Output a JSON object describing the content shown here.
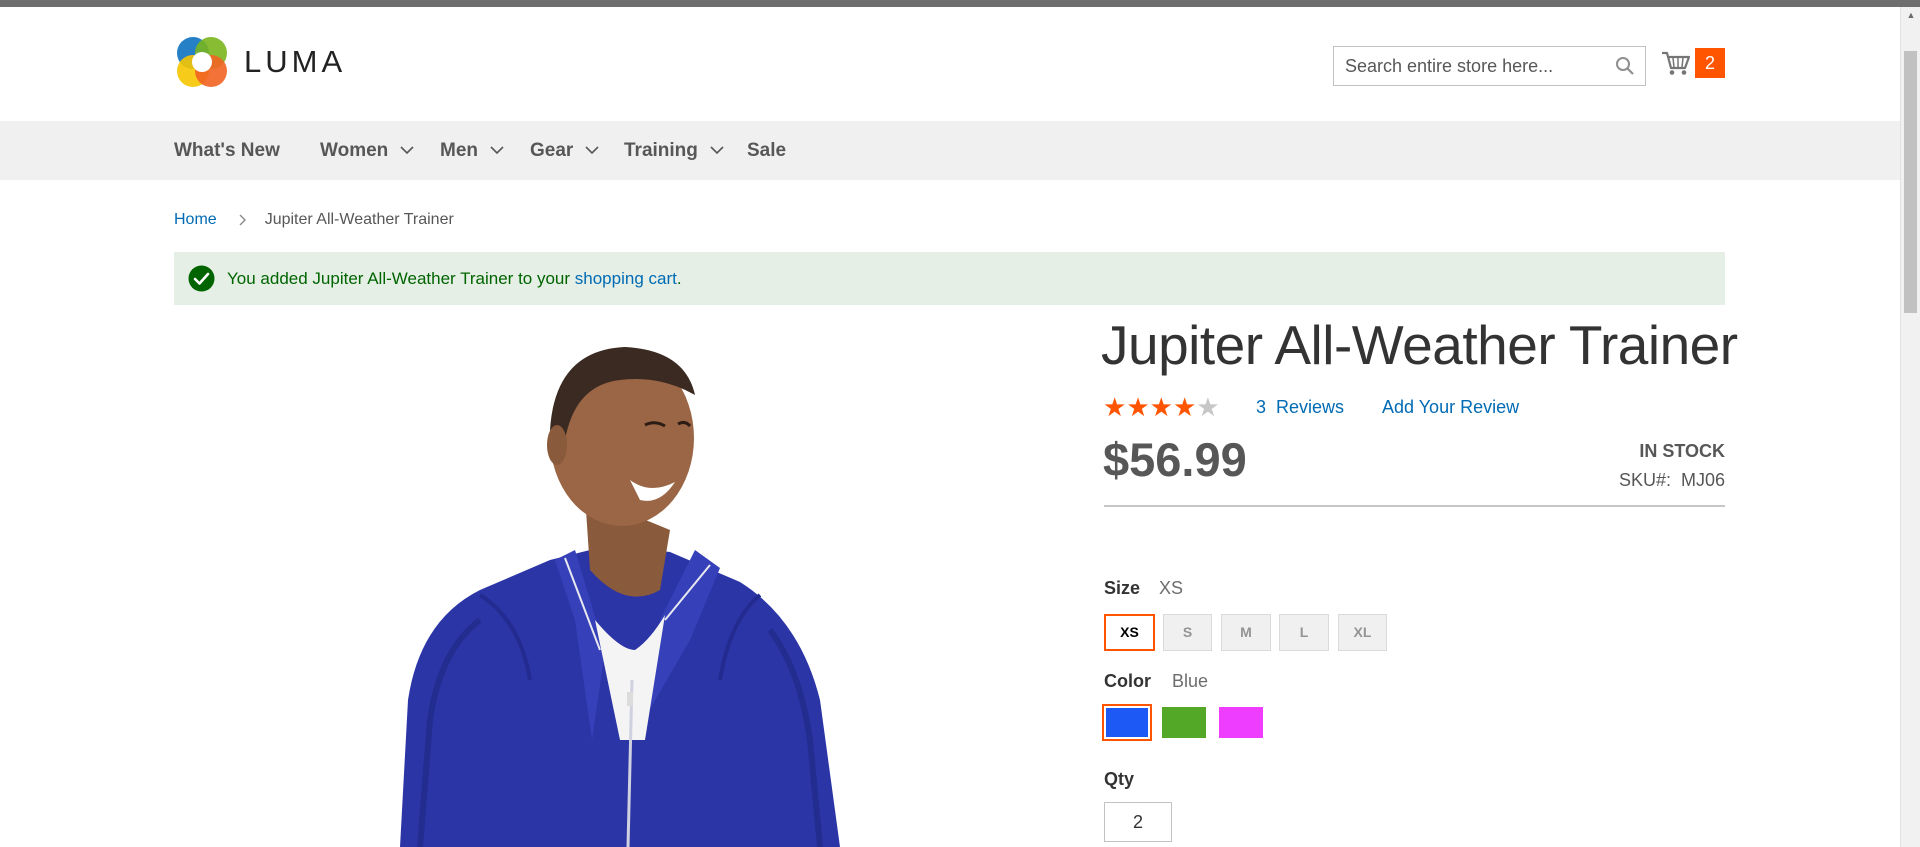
{
  "header": {
    "logo_text": "LUMA",
    "search_placeholder": "Search entire store here...",
    "cart_count": "2"
  },
  "nav": {
    "items": [
      {
        "label": "What's New",
        "has_submenu": false
      },
      {
        "label": "Women",
        "has_submenu": true
      },
      {
        "label": "Men",
        "has_submenu": true
      },
      {
        "label": "Gear",
        "has_submenu": true
      },
      {
        "label": "Training",
        "has_submenu": true
      },
      {
        "label": "Sale",
        "has_submenu": false
      }
    ]
  },
  "breadcrumb": {
    "home": "Home",
    "current": "Jupiter All-Weather Trainer"
  },
  "message": {
    "prefix": "You added Jupiter All-Weather Trainer to your ",
    "link": "shopping cart",
    "suffix": "."
  },
  "product": {
    "title": "Jupiter All-Weather Trainer",
    "rating_stars": 4,
    "rating_max": 5,
    "reviews_link": "3  Reviews",
    "add_review": "Add Your Review",
    "price": "$56.99",
    "stock": "IN STOCK",
    "sku_label": "SKU#:",
    "sku_value": "MJ06"
  },
  "options": {
    "size_label": "Size",
    "size_selected": "XS",
    "sizes": [
      "XS",
      "S",
      "M",
      "L",
      "XL"
    ],
    "color_label": "Color",
    "color_selected": "Blue",
    "colors": [
      {
        "name": "Blue",
        "hex": "#1d5af5"
      },
      {
        "name": "Green",
        "hex": "#53a828"
      },
      {
        "name": "Purple",
        "hex": "#ef3dff"
      }
    ],
    "qty_label": "Qty",
    "qty_value": "2"
  },
  "colors": {
    "accent": "#ff5501",
    "link": "#006bb4",
    "success_bg": "#e5efe5",
    "success_text": "#006400",
    "jacket": "#2c35a6"
  }
}
